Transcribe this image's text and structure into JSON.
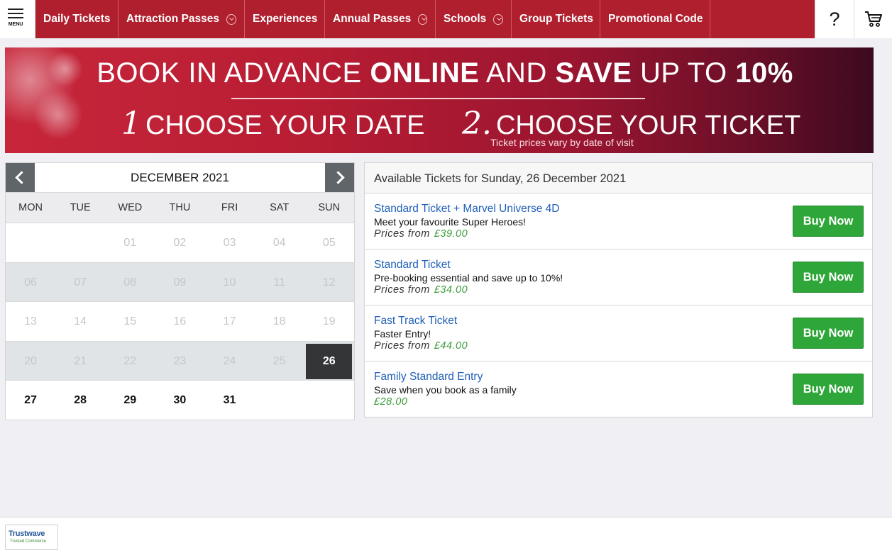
{
  "nav": {
    "menu_label": "MENU",
    "items": [
      {
        "label": "Daily Tickets",
        "dropdown": false
      },
      {
        "label": "Attraction Passes",
        "dropdown": true
      },
      {
        "label": "Experiences",
        "dropdown": false
      },
      {
        "label": "Annual Passes",
        "dropdown": true
      },
      {
        "label": "Schools",
        "dropdown": true
      },
      {
        "label": "Group Tickets",
        "dropdown": false
      },
      {
        "label": "Promotional Code",
        "dropdown": false
      }
    ],
    "help_label": "?",
    "icons": {
      "menu": "hamburger-icon",
      "cart": "cart-icon",
      "dropdown": "chevron-circle-down-icon"
    },
    "accent_color": "#b01f2e"
  },
  "banner": {
    "line1_parts": [
      "BOOK IN ADVANCE ",
      "ONLINE",
      " AND ",
      "SAVE",
      " UP TO ",
      "10%"
    ],
    "step1_num": "1",
    "step1_text": "CHOOSE YOUR DATE",
    "step2_num": "2.",
    "step2_text": "CHOOSE YOUR TICKET",
    "note": "Ticket prices vary by date of visit"
  },
  "calendar": {
    "month_label": "DECEMBER 2021",
    "weekdays": [
      "MON",
      "TUE",
      "WED",
      "THU",
      "FRI",
      "SAT",
      "SUN"
    ],
    "weeks": [
      [
        "",
        "",
        "01",
        "02",
        "03",
        "04",
        "05"
      ],
      [
        "06",
        "07",
        "08",
        "09",
        "10",
        "11",
        "12"
      ],
      [
        "13",
        "14",
        "15",
        "16",
        "17",
        "18",
        "19"
      ],
      [
        "20",
        "21",
        "22",
        "23",
        "24",
        "25",
        "26"
      ],
      [
        "27",
        "28",
        "29",
        "30",
        "31",
        "",
        ""
      ]
    ],
    "selected": "26",
    "available": [
      "26",
      "27",
      "28",
      "29",
      "30",
      "31"
    ],
    "icons": {
      "prev": "chevron-left-icon",
      "next": "chevron-right-icon"
    }
  },
  "tickets": {
    "header": "Available Tickets for Sunday, 26 December 2021",
    "buy_label": "Buy Now",
    "button_color": "#2fa63a",
    "items": [
      {
        "name": "Standard Ticket + Marvel Universe 4D",
        "desc": "Meet your favourite Super Heroes!",
        "price_prefix": "Prices from",
        "price": "£39.00"
      },
      {
        "name": "Standard Ticket",
        "desc": "Pre-booking essential and save up to 10%!",
        "price_prefix": "Prices from",
        "price": "£34.00"
      },
      {
        "name": "Fast Track Ticket",
        "desc": "Faster Entry!",
        "price_prefix": "Prices from",
        "price": "£44.00"
      },
      {
        "name": "Family Standard Entry",
        "desc": "Save when you book as a family",
        "price_prefix": "",
        "price": "£28.00"
      }
    ]
  },
  "footer": {
    "badge_title": "Trustwave",
    "badge_sub": "Trusted Commerce"
  }
}
